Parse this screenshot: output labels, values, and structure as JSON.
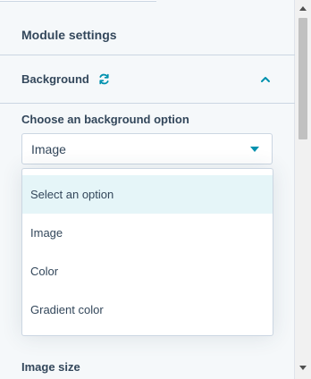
{
  "module": {
    "title": "Module settings"
  },
  "section": {
    "title": "Background"
  },
  "field": {
    "label": "Choose an background option",
    "selected": "Image"
  },
  "dropdown": {
    "options": [
      "Select an option",
      "Image",
      "Color",
      "Gradient color"
    ],
    "highlighted": "Select an option"
  },
  "next_field": {
    "label": "Image size"
  },
  "colors": {
    "accent": "#0091ae",
    "text": "#33475b",
    "highlight": "#e5f5f8",
    "border": "#cbd6e2"
  }
}
